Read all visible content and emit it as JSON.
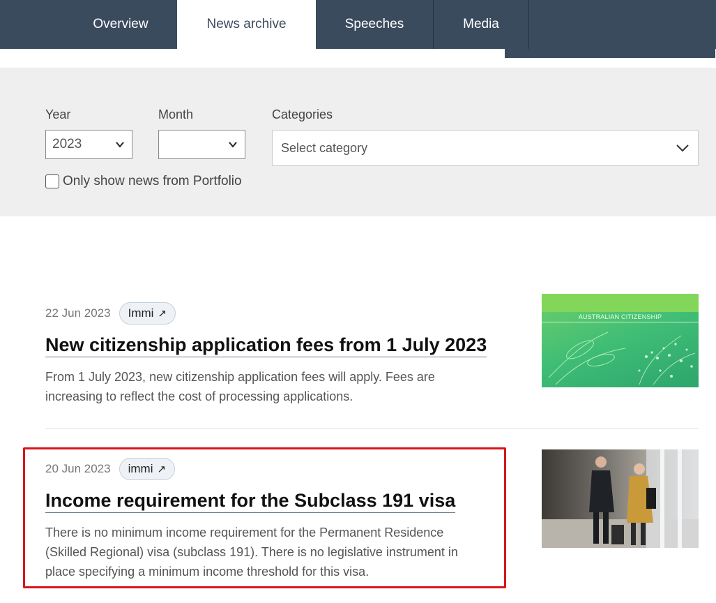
{
  "nav": {
    "tabs": [
      {
        "label": "Overview",
        "active": false
      },
      {
        "label": "News archive",
        "active": true
      },
      {
        "label": "Speeches",
        "active": false
      },
      {
        "label": "Media",
        "active": false
      }
    ]
  },
  "filters": {
    "year_label": "Year",
    "year_value": "2023",
    "month_label": "Month",
    "month_value": "",
    "categories_label": "Categories",
    "categories_placeholder": "Select category",
    "portfolio_checkbox_label": "Only show news from Portfolio",
    "portfolio_checked": false
  },
  "news": [
    {
      "date": "22 Jun 2023",
      "badge": "Immi",
      "title": "New citizenship application fees from 1 July 2023",
      "description": "From 1 July 2023, new citizenship application fees will apply. Fees are increasing to reflect the cost of processing applications.",
      "thumbnail_caption": "AUSTRALIAN CITIZENSHIP"
    },
    {
      "date": "20 Jun 2023",
      "badge": "immi",
      "title": "Income requirement for the Subclass 191 visa",
      "description": "There is no minimum income requirement for the Permanent Residence (Skilled Regional) visa (subclass 191). There is no legislative instrument in place specifying a minimum income threshold for this visa.",
      "highlighted": true
    }
  ],
  "colors": {
    "nav_bg": "#3b4b5e",
    "filter_bg": "#efefef",
    "highlight": "#d9141b"
  }
}
